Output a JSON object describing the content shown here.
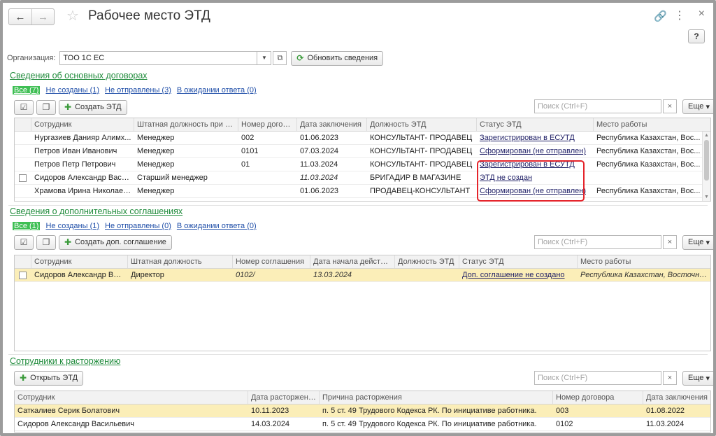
{
  "window": {
    "title": "Рабочее место ЭТД"
  },
  "org": {
    "label": "Организация:",
    "value": "ТОО 1С ЕС",
    "refresh_label": "Обновить сведения"
  },
  "help_label": "?",
  "search_placeholder": "Поиск (Ctrl+F)",
  "more_label": "Еще",
  "contracts": {
    "title": "Сведения об основных договорах",
    "filters": [
      "Все (7)",
      "Не созданы (1)",
      "Не отправлены (3)",
      "В ожидании ответа (0)"
    ],
    "create_label": "Создать ЭТД",
    "columns": [
      "Сотрудник",
      "Штатная должность при пр...",
      "Номер догово...",
      "Дата заключения",
      "Должность ЭТД",
      "Статус ЭТД",
      "Место работы"
    ],
    "rows": [
      [
        "Нургазиев Данияр Алимх...",
        "Менеджер",
        "002",
        "01.06.2023",
        "КОНСУЛЬТАНТ- ПРОДАВЕЦ",
        "Зарегистрирован в ЕСУТД",
        "Республика Казахстан, Вос..."
      ],
      [
        "Петров Иван Иванович",
        "Менеджер",
        "0101",
        "07.03.2024",
        "КОНСУЛЬТАНТ- ПРОДАВЕЦ",
        "Сформирован (не отправлен)",
        "Республика Казахстан, Вос..."
      ],
      [
        "Петров Петр Петрович",
        "Менеджер",
        "01",
        "11.03.2024",
        "КОНСУЛЬТАНТ- ПРОДАВЕЦ",
        "Зарегистрирован в ЕСУТД",
        "Республика Казахстан, Вос..."
      ],
      [
        "Сидоров Александр Васил...",
        "Старший менеджер",
        "",
        "11.03.2024",
        "БРИГАДИР В МАГАЗИНЕ",
        "ЭТД не создан",
        ""
      ],
      [
        "Храмова Ирина Николаев...",
        "Менеджер",
        "",
        "01.06.2023",
        "ПРОДАВЕЦ-КОНСУЛЬТАНТ",
        "Сформирован (не отправлен)",
        "Республика Казахстан, Вос..."
      ]
    ]
  },
  "agreements": {
    "title": "Сведения о дополнительных соглашениях",
    "filters": [
      "Все (1)",
      "Не созданы (1)",
      "Не отправлены (0)",
      "В ожидании ответа (0)"
    ],
    "create_label": "Создать доп. соглашение",
    "columns": [
      "Сотрудник",
      "Штатная должность",
      "Номер соглашения",
      "Дата начала действия",
      "Должность ЭТД",
      "Статус ЭТД",
      "Место работы"
    ],
    "rows": [
      [
        "Сидоров Александр Вас...",
        "Директор",
        "0102/",
        "13.03.2024",
        "",
        "Доп. соглашение не создано",
        "Республика Казахстан, Восточно-К..."
      ]
    ]
  },
  "terminations": {
    "title": "Сотрудники к расторжению",
    "open_label": "Открыть ЭТД",
    "columns": [
      "Сотрудник",
      "Дата расторжения",
      "Причина расторжения",
      "Номер договора",
      "Дата заключения"
    ],
    "rows": [
      [
        "Саткалиев Серик Болатович",
        "10.11.2023",
        "п. 5 ст. 49 Трудового Кодекса РК. По инициативе работника.",
        "003",
        "01.08.2022"
      ],
      [
        "Сидоров Александр Васильевич",
        "14.03.2024",
        "п. 5 ст. 49 Трудового Кодекса РК. По инициативе работника.",
        "0102",
        "11.03.2024"
      ]
    ]
  }
}
